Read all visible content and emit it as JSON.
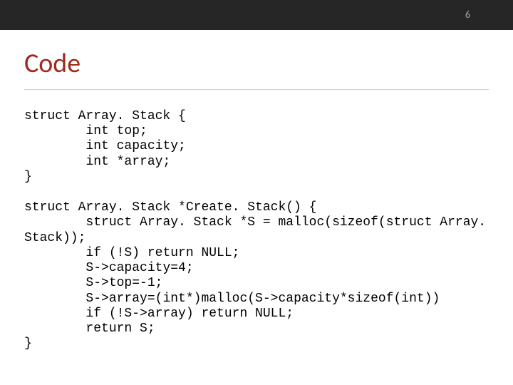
{
  "page_number": "6",
  "title": "Code",
  "code_block_1": "struct Array. Stack {\n\tint top;\n\tint capacity;\n\tint *array;\n}",
  "code_block_2": "struct Array. Stack *Create. Stack() {\n\tstruct Array. Stack *S = malloc(sizeof(struct Array. Stack));\n\tif (!S) return NULL;\n\tS->capacity=4;\n\tS->top=-1;\n\tS->array=(int*)malloc(S->capacity*sizeof(int))\n\tif (!S->array) return NULL;\n\treturn S;\n}"
}
